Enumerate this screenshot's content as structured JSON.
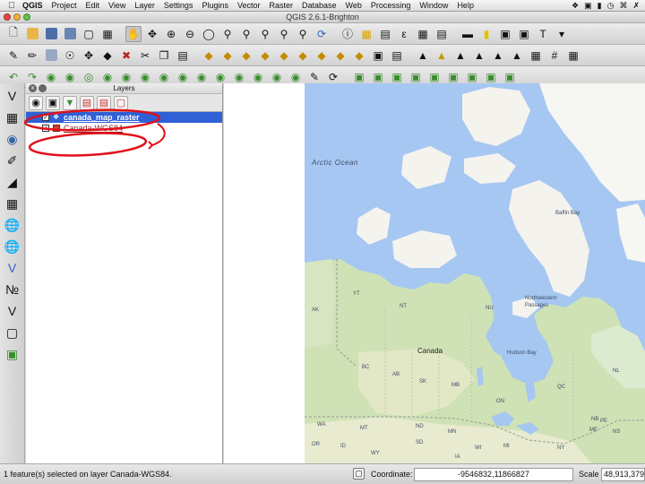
{
  "menubar": {
    "items": [
      "QGIS",
      "Project",
      "Edit",
      "View",
      "Layer",
      "Settings",
      "Plugins",
      "Vector",
      "Raster",
      "Database",
      "Web",
      "Processing",
      "Window",
      "Help"
    ],
    "tray_icons": [
      "dropbox-icon",
      "box-icon",
      "battery-icon",
      "clock-icon",
      "wifi-icon",
      "bluetooth-icon"
    ]
  },
  "window": {
    "title": "QGIS 2.6.1-Brighton"
  },
  "layers_panel": {
    "title": "Layers",
    "close_glyph": "x",
    "layers": [
      {
        "name": "canada_map_raster",
        "checked": true,
        "selected": true,
        "icon": "raster-layer-icon"
      },
      {
        "name": "Canada-WGS84",
        "checked": true,
        "selected": false,
        "icon": "polygon-layer-icon"
      }
    ]
  },
  "map": {
    "labels": {
      "arctic_ocean": "Arctic Ocean",
      "baffin_bay": "Baffin Bay",
      "northwestern_passages": "Northwestern\nPassages",
      "canada": "Canada",
      "hudson_bay": "Hudson Bay",
      "nu": "NU",
      "nt": "NT",
      "yt": "YT",
      "bc": "BC",
      "ab": "AB",
      "sk": "SK",
      "mb": "MB",
      "on": "ON",
      "qc": "QC",
      "nl": "NL",
      "ak": "AK",
      "wa": "WA",
      "mt": "MT",
      "nd": "ND",
      "mn": "MN",
      "or": "OR",
      "id": "ID",
      "sd": "SD",
      "wy": "WY",
      "wi": "WI",
      "mi": "MI",
      "ny": "NY",
      "me": "ME",
      "pe": "PE",
      "ns": "NS",
      "nb": "NB",
      "ia": "IA"
    },
    "colors": {
      "water": "#a6c7f2",
      "land": "#f2efe6",
      "forest": "#cde2b3",
      "arctic": "#f6f6f2"
    }
  },
  "status": {
    "message": "1 feature(s) selected on layer Canada-WGS84.",
    "coordinate_label": "Coordinate:",
    "coordinate_value": "-9546832,11866827",
    "scale_label": "Scale",
    "scale_value": "48,913,379"
  },
  "annotation": {
    "color": "#e0101a"
  }
}
